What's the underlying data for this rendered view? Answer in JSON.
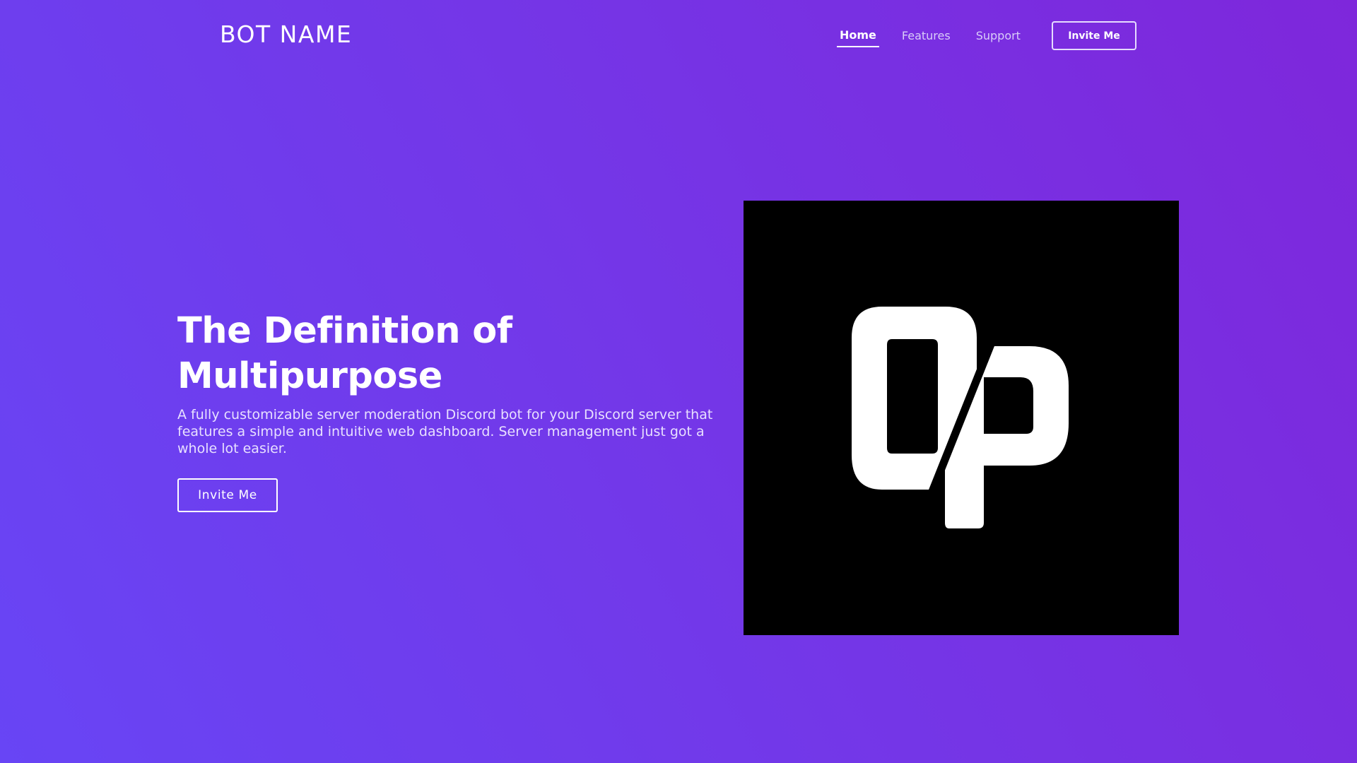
{
  "brand": {
    "name": "BOT NAME"
  },
  "nav": {
    "items": [
      {
        "label": "Home",
        "active": true
      },
      {
        "label": "Features",
        "active": false
      },
      {
        "label": "Support",
        "active": false
      }
    ],
    "invite_label": "Invite Me"
  },
  "hero": {
    "title_line1": "The Definition of",
    "title_line2": "Multipurpose",
    "description": "A fully customizable server moderation Discord bot for your Discord server that features a simple and intuitive web dashboard. Server management just got a whole lot easier.",
    "invite_label": "Invite Me"
  },
  "logo": {
    "icon": "op-logo-icon",
    "background": "#000000",
    "foreground": "#ffffff"
  },
  "colors": {
    "gradient_start": "#6845f5",
    "gradient_end": "#7e27db",
    "text": "#ffffff"
  }
}
